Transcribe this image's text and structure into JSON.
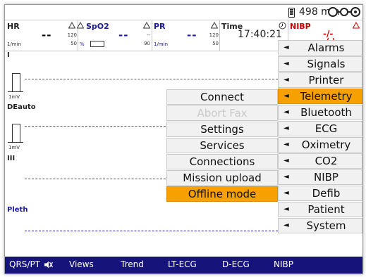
{
  "status": {
    "battery_icon": "battery-icon",
    "minutes": "498 min",
    "connection_icon": "connection-icon"
  },
  "params": {
    "hr": {
      "label": "HR",
      "value": "--",
      "limit_high": "120",
      "limit_low": "50",
      "unit": "1/min"
    },
    "spo2": {
      "label": "SpO2",
      "value": "--",
      "limit_high": "--",
      "limit_low": "90",
      "unit": "%"
    },
    "pr": {
      "label": "PR",
      "value": "--",
      "limit_high": "120",
      "limit_low": "50",
      "unit": "1/min"
    },
    "time": {
      "label": "Time",
      "value": "17:40:21"
    },
    "nibp": {
      "label": "NIBP",
      "value": "-/-",
      "sub": "(-)"
    },
    "label_color": "#1a1aa0",
    "alarm_color": "#cc0000"
  },
  "channels": [
    {
      "label": "I",
      "calibration": "1mV"
    },
    {
      "label": "DEauto",
      "calibration": "1mV"
    },
    {
      "label": "III",
      "calibration": ""
    },
    {
      "label": "Pleth",
      "calibration": ""
    }
  ],
  "main_menu": {
    "arrow": "◄",
    "items": [
      "Alarms",
      "Signals",
      "Printer",
      "Telemetry",
      "Bluetooth",
      "ECG",
      "Oximetry",
      "CO2",
      "NIBP",
      "Defib",
      "Patient",
      "System"
    ],
    "selected": "Telemetry"
  },
  "telemetry_menu": {
    "items": [
      "Connect",
      "Abort Fax",
      "Settings",
      "Services",
      "Connections",
      "Mission upload",
      "Offline mode"
    ],
    "disabled": [
      "Abort Fax"
    ],
    "selected": "Offline mode"
  },
  "softkeys": {
    "qrs": "QRS/PT",
    "views": "Views",
    "trend": "Trend",
    "lt_ecg": "LT-ECG",
    "d_ecg": "D-ECG",
    "nibp": "NIBP"
  },
  "colors": {
    "highlight": "#f7a100",
    "softkey_bar": "#16147a",
    "menu_bg": "#f1f1f1"
  }
}
